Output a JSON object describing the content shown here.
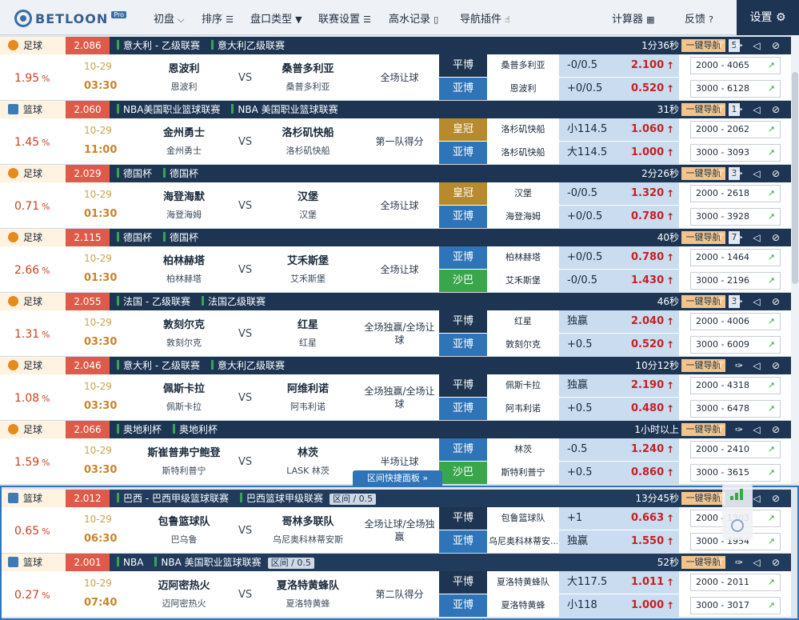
{
  "nav": {
    "brand": "BETLOON",
    "brand_badge": "Pro",
    "items": [
      {
        "label": "初盘",
        "icon": "chevron-down-icon",
        "glyph": "⌵"
      },
      {
        "label": "排序",
        "icon": "list-icon",
        "glyph": "☰"
      },
      {
        "label": "盘口类型",
        "icon": "filter-icon",
        "glyph": "▼"
      },
      {
        "label": "联赛设置",
        "icon": "list-icon",
        "glyph": "☰"
      },
      {
        "label": "高水记录",
        "icon": "document-icon",
        "glyph": "▯"
      },
      {
        "label": "导航插件",
        "icon": "pointer-icon",
        "glyph": "☝"
      },
      {
        "label": "计算器",
        "icon": "calculator-icon",
        "glyph": "▦"
      },
      {
        "label": "反馈",
        "icon": "help-icon",
        "glyph": "?"
      }
    ],
    "settings": "设置",
    "settings_glyph": "⚙"
  },
  "common": {
    "jump": "一键导航",
    "vs": "VS",
    "pct_unit": "%",
    "up_arrow": "↑",
    "spark": "↗",
    "panel_label": "区间快捷面板",
    "icon_pin": "⊤",
    "icon_tack": "✑",
    "icon_mute": "◁",
    "icon_block": "⊘"
  },
  "colors": {
    "navy": "#1d3552",
    "blue": "#2f74b8",
    "gold": "#b88a2e",
    "green": "#3aa64c",
    "red": "#c8201f",
    "orange": "#e05a4a"
  },
  "matches": [
    {
      "sport": "足球",
      "sport_icon": "football-icon",
      "odd": "2.086",
      "league1": "意大利 - 乙级联赛",
      "league2": "意大利乙级联赛",
      "tag": "",
      "time": "1分36秒",
      "count": "5",
      "pct": "1.95",
      "date": "10-29",
      "kick": "03:30",
      "home": "恩波利",
      "home_sub": "恩波利",
      "away": "桑普多利亚",
      "away_sub": "桑普多利亚",
      "market": "全场让球",
      "rows": [
        {
          "book": "平博",
          "cls": "c-ph",
          "sel": "桑普多利亚",
          "line": "-0/0.5",
          "price": "2.100",
          "vol": "2000 - 4065"
        },
        {
          "book": "亚博",
          "cls": "c-yb",
          "sel": "恩波利",
          "line": "+0/0.5",
          "price": "0.520",
          "vol": "3000 - 6128"
        }
      ]
    },
    {
      "sport": "篮球",
      "sport_icon": "basketball-icon",
      "odd": "2.060",
      "league1": "NBA美国职业篮球联赛",
      "league2": "NBA 美国职业篮球联赛",
      "tag": "",
      "time": "31秒",
      "count": "1",
      "pct": "1.45",
      "date": "10-29",
      "kick": "11:00",
      "home": "金州勇士",
      "home_sub": "金州勇士",
      "away": "洛杉矶快船",
      "away_sub": "洛杉矶快船",
      "market": "第一队得分",
      "rows": [
        {
          "book": "皇冠",
          "cls": "c-hg",
          "sel": "洛杉矶快船",
          "line": "小114.5",
          "price": "1.060",
          "vol": "2000 - 2062"
        },
        {
          "book": "亚博",
          "cls": "c-yb",
          "sel": "洛杉矶快船",
          "line": "大114.5",
          "price": "1.000",
          "vol": "3000 - 3093"
        }
      ]
    },
    {
      "sport": "足球",
      "sport_icon": "football-icon",
      "odd": "2.029",
      "league1": "德国杯",
      "league2": "德国杯",
      "tag": "",
      "time": "2分26秒",
      "count": "3",
      "pct": "0.71",
      "date": "10-29",
      "kick": "01:30",
      "home": "海登海默",
      "home_sub": "海登海姆",
      "away": "汉堡",
      "away_sub": "汉堡",
      "market": "全场让球",
      "rows": [
        {
          "book": "皇冠",
          "cls": "c-hg",
          "sel": "汉堡",
          "line": "-0/0.5",
          "price": "1.320",
          "vol": "2000 - 2618"
        },
        {
          "book": "亚博",
          "cls": "c-yb",
          "sel": "海登海姆",
          "line": "+0/0.5",
          "price": "0.780",
          "vol": "3000 - 3928"
        }
      ]
    },
    {
      "sport": "足球",
      "sport_icon": "football-icon",
      "odd": "2.115",
      "league1": "德国杯",
      "league2": "德国杯",
      "tag": "",
      "time": "40秒",
      "count": "7",
      "pct": "2.66",
      "date": "10-29",
      "kick": "01:30",
      "home": "柏林赫塔",
      "home_sub": "柏林赫塔",
      "away": "艾禾斯堡",
      "away_sub": "艾禾斯堡",
      "market": "全场让球",
      "rows": [
        {
          "book": "亚博",
          "cls": "c-yb",
          "sel": "柏林赫塔",
          "line": "+0/0.5",
          "price": "0.780",
          "vol": "2000 - 1464"
        },
        {
          "book": "沙巴",
          "cls": "c-sb",
          "sel": "艾禾斯堡",
          "line": "-0/0.5",
          "price": "1.430",
          "vol": "3000 - 2196"
        }
      ]
    },
    {
      "sport": "足球",
      "sport_icon": "football-icon",
      "odd": "2.055",
      "league1": "法国 - 乙级联赛",
      "league2": "法国乙级联赛",
      "tag": "",
      "time": "46秒",
      "count": "3",
      "pct": "1.31",
      "date": "10-29",
      "kick": "03:30",
      "home": "敦刻尔克",
      "home_sub": "敦刻尔克",
      "away": "红星",
      "away_sub": "红星",
      "market": "全场独赢/全场让球",
      "rows": [
        {
          "book": "平博",
          "cls": "c-ph",
          "sel": "红星",
          "line": "独赢",
          "price": "2.040",
          "vol": "2000 - 4006"
        },
        {
          "book": "亚博",
          "cls": "c-yb",
          "sel": "敦刻尔克",
          "line": "+0.5",
          "price": "0.520",
          "vol": "3000 - 6009"
        }
      ]
    },
    {
      "sport": "足球",
      "sport_icon": "football-icon",
      "odd": "2.046",
      "league1": "意大利 - 乙级联赛",
      "league2": "意大利乙级联赛",
      "tag": "",
      "time": "10分12秒",
      "count": "",
      "pct": "1.08",
      "date": "10-29",
      "kick": "03:30",
      "home": "佩斯卡拉",
      "home_sub": "佩斯卡拉",
      "away": "阿维利诺",
      "away_sub": "阿韦利诺",
      "market": "全场独赢/全场让球",
      "rows": [
        {
          "book": "平博",
          "cls": "c-ph",
          "sel": "佩斯卡拉",
          "line": "独赢",
          "price": "2.190",
          "vol": "2000 - 4318"
        },
        {
          "book": "亚博",
          "cls": "c-yb",
          "sel": "阿韦利诺",
          "line": "+0.5",
          "price": "0.480",
          "vol": "3000 - 6478"
        }
      ]
    },
    {
      "sport": "足球",
      "sport_icon": "football-icon",
      "odd": "2.066",
      "league1": "奥地利杯",
      "league2": "奥地利杯",
      "tag": "",
      "time": "1小时以上",
      "count": "",
      "pct": "1.59",
      "date": "10-29",
      "kick": "03:30",
      "home": "斯崔普弗宁鲍登",
      "home_sub": "斯特利普宁",
      "away": "林茨",
      "away_sub": "LASK 林茨",
      "market": "半场让球",
      "rows": [
        {
          "book": "亚博",
          "cls": "c-yb",
          "sel": "林茨",
          "line": "-0.5",
          "price": "1.240",
          "vol": "2000 - 2410"
        },
        {
          "book": "沙巴",
          "cls": "c-sb",
          "sel": "斯特利普宁",
          "line": "+0.5",
          "price": "0.860",
          "vol": "3000 - 3615"
        }
      ]
    },
    {
      "sport": "篮球",
      "sport_icon": "basketball-icon",
      "odd": "2.012",
      "league1": "巴西 - 巴西甲级篮球联赛",
      "league2": "巴西篮球甲级联赛",
      "tag": "区间 / 0.5",
      "time": "13分45秒",
      "count": "",
      "pct": "0.65",
      "date": "10-29",
      "kick": "06:30",
      "home": "包鲁篮球队",
      "home_sub": "巴乌鲁",
      "away": "哥林多联队",
      "away_sub": "乌尼奥科林蒂安斯",
      "market": "全场让球/全场独赢",
      "rows": [
        {
          "book": "平博",
          "cls": "c-ph",
          "sel": "包鲁篮球队",
          "line": "+1",
          "price": "0.663",
          "vol": "2000 - 1303"
        },
        {
          "book": "亚博",
          "cls": "c-yb",
          "sel": "乌尼奥科林蒂安...",
          "line": "独赢",
          "price": "1.550",
          "vol": "3000 - 1954"
        }
      ]
    },
    {
      "sport": "篮球",
      "sport_icon": "basketball-icon",
      "odd": "2.001",
      "league1": "NBA",
      "league2": "NBA 美国职业篮球联赛",
      "tag": "区间 / 0.5",
      "time": "52秒",
      "count": "",
      "pct": "0.27",
      "date": "10-29",
      "kick": "07:40",
      "home": "迈阿密热火",
      "home_sub": "迈阿密热火",
      "away": "夏洛特黄蜂队",
      "away_sub": "夏洛特黄蜂",
      "market": "第二队得分",
      "rows": [
        {
          "book": "平博",
          "cls": "c-ph",
          "sel": "夏洛特黄蜂队",
          "line": "大117.5",
          "price": "1.011",
          "vol": "2000 - 2011"
        },
        {
          "book": "亚博",
          "cls": "c-yb",
          "sel": "夏洛特黄蜂",
          "line": "小118",
          "price": "1.000",
          "vol": "3000 - 3017"
        }
      ]
    }
  ]
}
